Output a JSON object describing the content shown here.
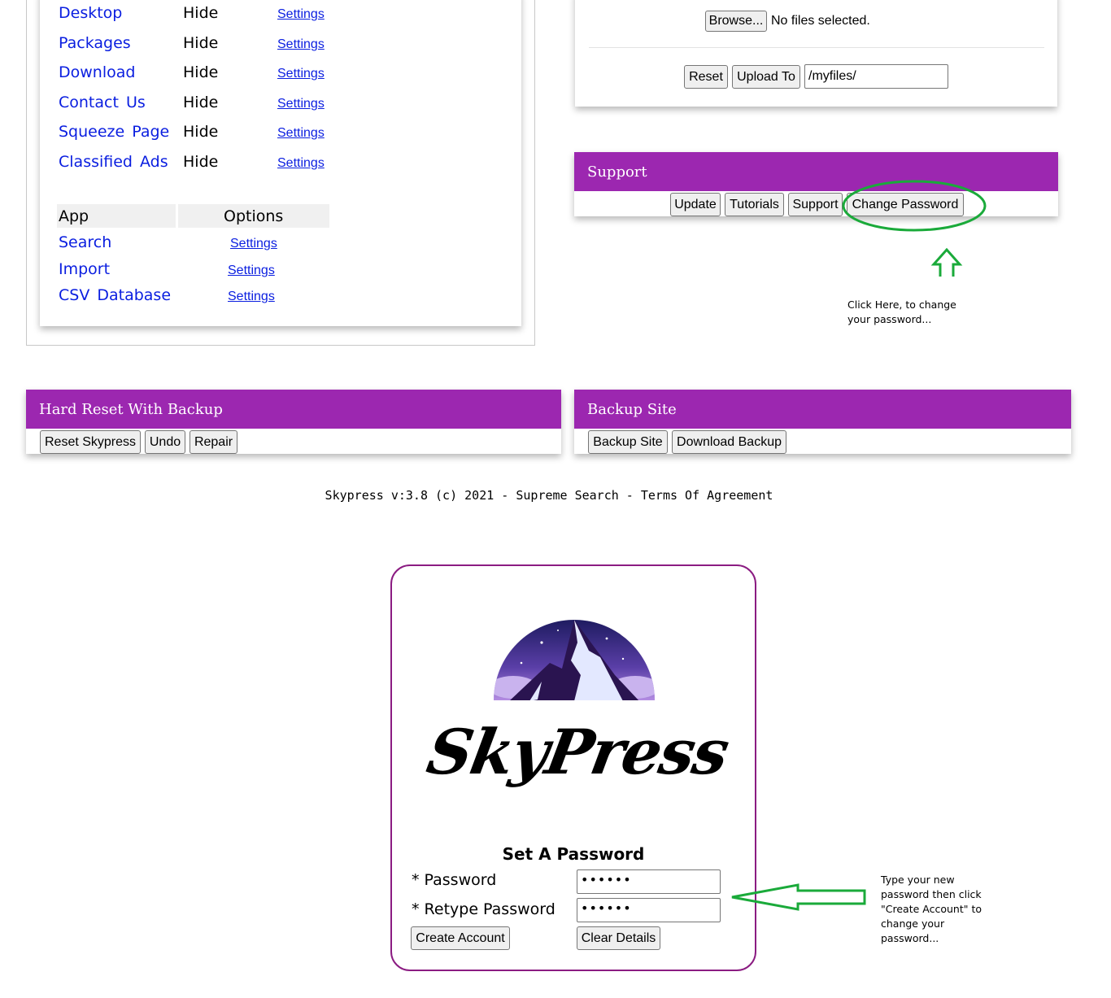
{
  "colors": {
    "purple": "#9c27b0",
    "link_blue": "#0a1ee0",
    "annotation_green": "#1aaa3a",
    "login_border": "#8b1c82"
  },
  "apps_panel": {
    "rows": [
      {
        "name": "Desktop",
        "state": "Hide",
        "settings": "Settings"
      },
      {
        "name": "Packages",
        "state": "Hide",
        "settings": "Settings"
      },
      {
        "name": "Download",
        "state": "Hide",
        "settings": "Settings"
      },
      {
        "name": "Contact Us",
        "state": "Hide",
        "settings": "Settings"
      },
      {
        "name": "Squeeze Page",
        "state": "Hide",
        "settings": "Settings"
      },
      {
        "name": "Classified Ads",
        "state": "Hide",
        "settings": "Settings"
      }
    ],
    "table_headers": {
      "app": "App",
      "options": "Options"
    },
    "table_rows": [
      {
        "name": "Search",
        "settings": "Settings"
      },
      {
        "name": "Import",
        "settings": "Settings"
      },
      {
        "name": "CSV Database",
        "settings": "Settings"
      }
    ]
  },
  "upload_panel": {
    "browse_label": "Browse...",
    "no_files_text": "No files selected.",
    "reset_label": "Reset",
    "upload_label": "Upload To",
    "path_value": "/myfiles/"
  },
  "support_panel": {
    "title": "Support",
    "buttons": [
      "Update",
      "Tutorials",
      "Support",
      "Change Password"
    ]
  },
  "annotation_change_password": {
    "line1": "Click Here, to change",
    "line2": "your password..."
  },
  "hard_reset_panel": {
    "title": "Hard Reset With Backup",
    "buttons": [
      "Reset Skypress",
      "Undo",
      "Repair"
    ]
  },
  "backup_panel": {
    "title": "Backup Site",
    "buttons": [
      "Backup Site",
      "Download Backup"
    ]
  },
  "footer": {
    "text": "Skypress v:3.8 (c) 2021 - Supreme Search - Terms Of Agreement"
  },
  "login": {
    "logo_text": "SkyPress",
    "heading": "Set A Password",
    "password_label": "* Password",
    "retype_label": "* Retype Password",
    "password_value": "••••••",
    "retype_value": "••••••",
    "create_label": "Create Account",
    "clear_label": "Clear Details"
  },
  "annotation_password": {
    "lines": [
      "Type your new",
      "password then click",
      "\"Create Account\" to",
      "change your",
      "password..."
    ]
  }
}
